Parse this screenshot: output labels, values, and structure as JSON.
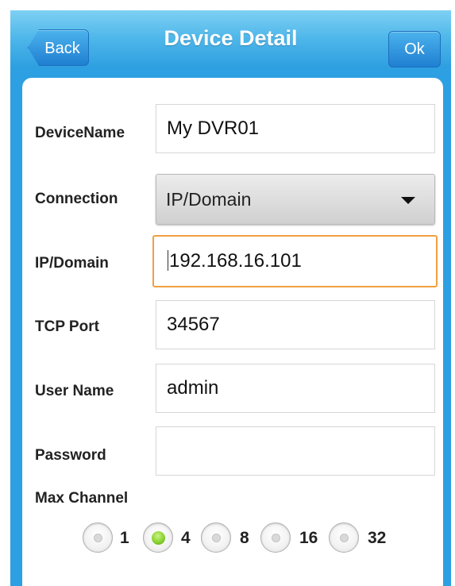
{
  "header": {
    "title": "Device Detail",
    "back_label": "Back",
    "ok_label": "Ok"
  },
  "form": {
    "device_name": {
      "label": "DeviceName",
      "value": "My DVR01"
    },
    "connection": {
      "label": "Connection",
      "value": "IP/Domain"
    },
    "ip_domain": {
      "label": "IP/Domain",
      "value": "192.168.16.101"
    },
    "tcp_port": {
      "label": "TCP Port",
      "value": "34567"
    },
    "user_name": {
      "label": "User Name",
      "value": "admin"
    },
    "password": {
      "label": "Password",
      "value": ""
    },
    "max_channel": {
      "label": "Max Channel",
      "options": [
        "1",
        "4",
        "8",
        "16",
        "32"
      ],
      "selected": "4"
    }
  },
  "colors": {
    "header_blue": "#4fb7ea",
    "frame_blue": "#2ca0e2",
    "focus_orange": "#f0a040",
    "radio_selected_green": "#8bd32e"
  },
  "icons": {
    "dropdown": "chevron-down-icon"
  }
}
